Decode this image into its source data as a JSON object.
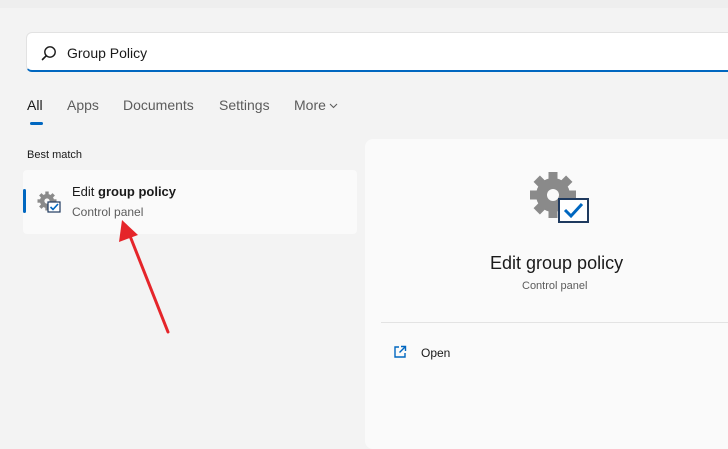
{
  "search": {
    "query": "Group Policy"
  },
  "tabs": [
    {
      "label": "All"
    },
    {
      "label": "Apps"
    },
    {
      "label": "Documents"
    },
    {
      "label": "Settings"
    },
    {
      "label": "More"
    }
  ],
  "best_match": {
    "section_label": "Best match",
    "title_prefix": "Edit ",
    "title_bold": "group policy",
    "subtitle": "Control panel"
  },
  "details": {
    "title": "Edit group policy",
    "subtitle": "Control panel",
    "actions": [
      {
        "label": "Open",
        "icon": "open-external-icon"
      }
    ]
  },
  "colors": {
    "accent": "#0067c0",
    "annotation_arrow": "#e5252a"
  }
}
